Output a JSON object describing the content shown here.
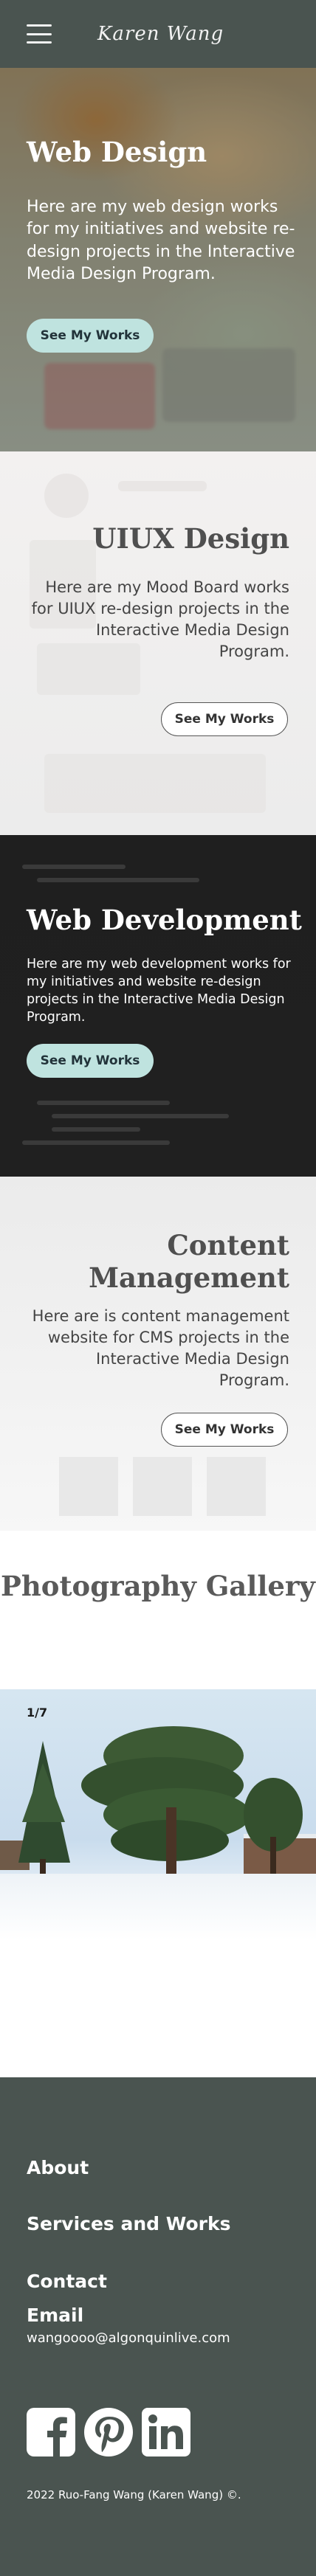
{
  "header": {
    "brand": "Karen Wang",
    "menu_icon": "hamburger-menu-icon"
  },
  "sections": {
    "web_design": {
      "title": "Web Design",
      "description": "Here are my web design works for my initiatives and website re-design projects in the Interactive Media Design Program.",
      "button": "See My Works"
    },
    "uiux": {
      "title": "UIUX Design",
      "description": "Here are my Mood Board works for UIUX re-design projects in the Interactive Media Design Program.",
      "button": "See My Works"
    },
    "web_dev": {
      "title": "Web Development",
      "description": "Here are my web development works for my initiatives and website re-design projects in the Interactive Media Design Program.",
      "button": "See My Works"
    },
    "content_mgmt": {
      "title": "Content Management",
      "description": "Here are is content management website for CMS projects in the Interactive Media Design Program.",
      "button": "See My Works"
    }
  },
  "gallery": {
    "title": "Photography Gallery",
    "slide_counter": "1/7"
  },
  "footer": {
    "links": [
      "About",
      "Services and Works",
      "Contact",
      "Email"
    ],
    "email": "wangoooo@algonquinlive.com",
    "social_icons": [
      "facebook-icon",
      "pinterest-icon",
      "linkedin-icon"
    ],
    "copyright": "2022 Ruo-Fang Wang (Karen Wang) ©."
  },
  "colors": {
    "header_bg": "#4a5450",
    "accent_button": "#bfe3df",
    "dark_section": "#1f1f1f"
  }
}
